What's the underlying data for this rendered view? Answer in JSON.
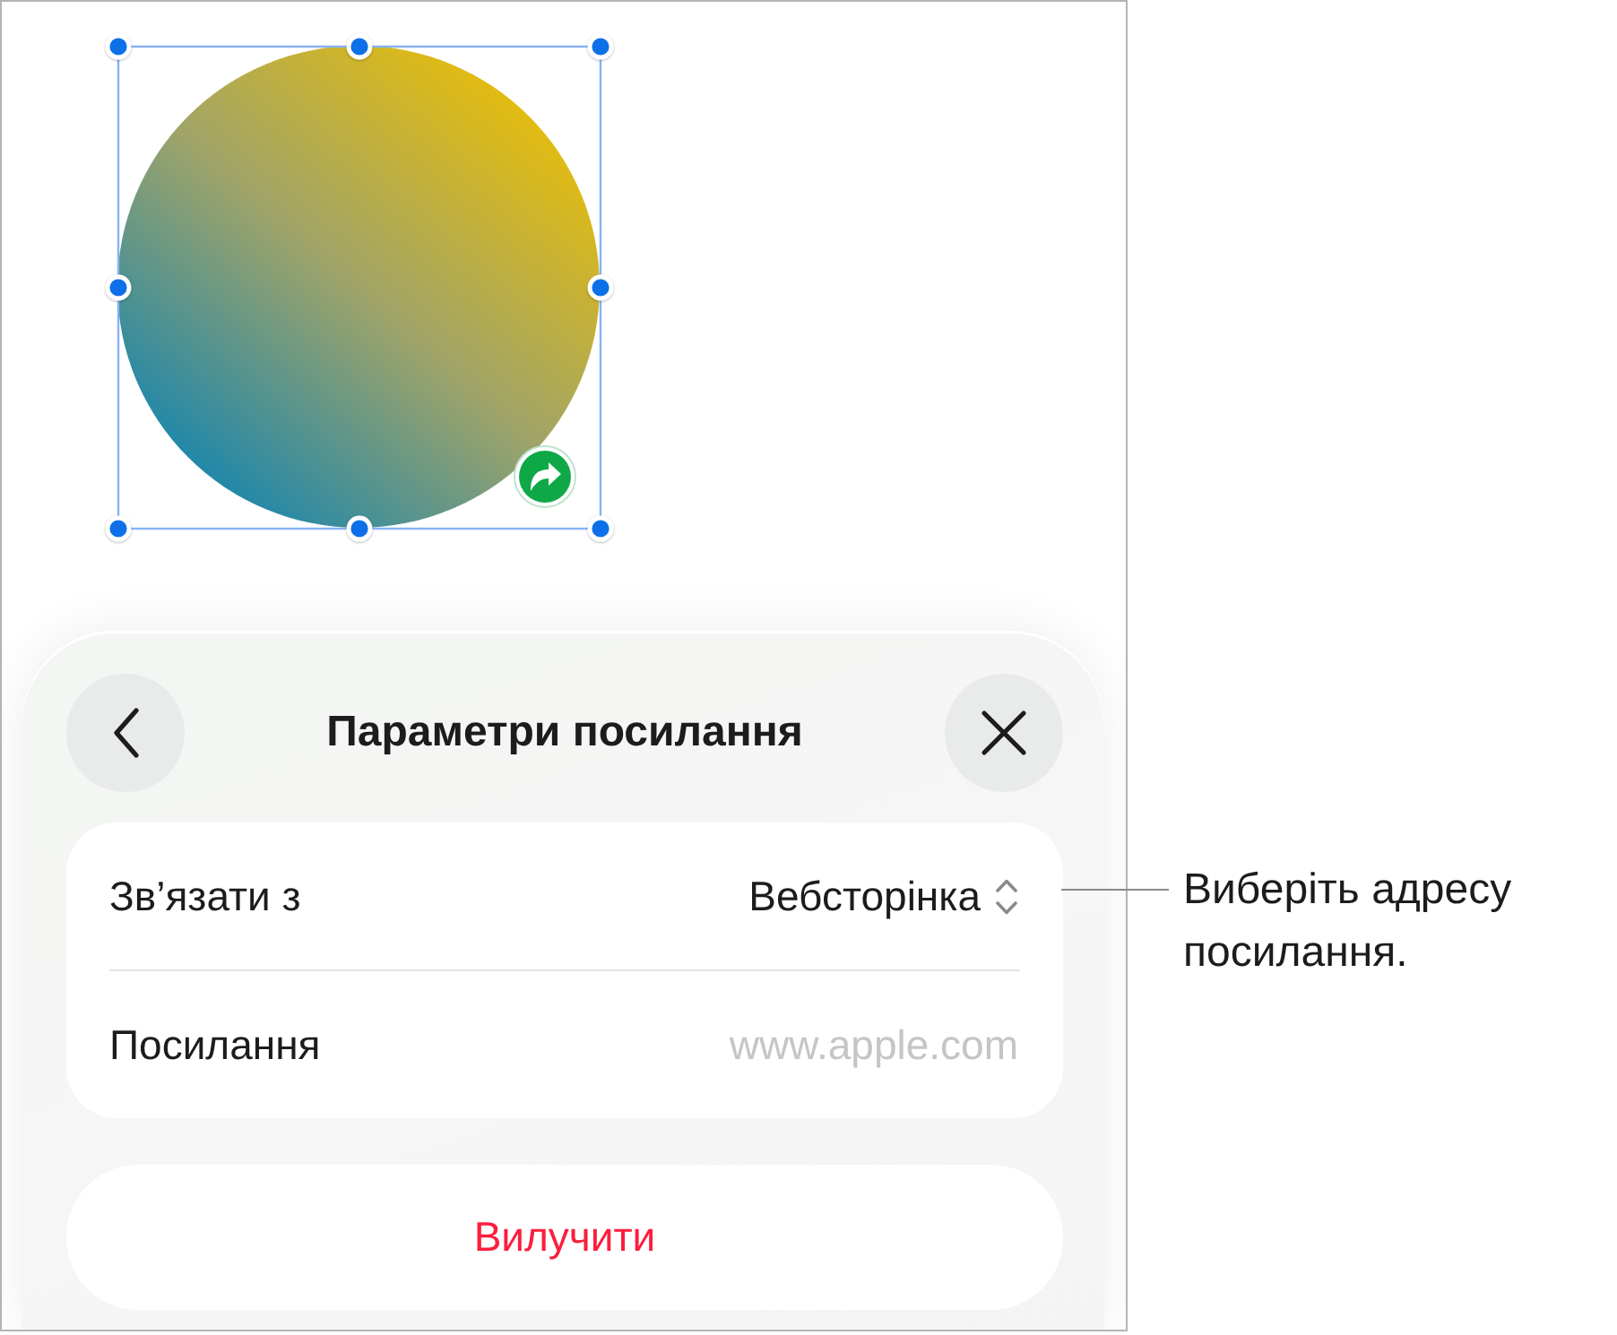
{
  "canvas": {
    "shape": {
      "selected": true,
      "link_badge": true
    }
  },
  "sheet": {
    "title": "Параметри посилання",
    "rows": [
      {
        "kind": "popup",
        "label": "Зв’язати з",
        "value": "Вебсторінка"
      },
      {
        "kind": "field",
        "label": "Посилання",
        "placeholder": "www.apple.com"
      }
    ],
    "delete_button": "Вилучити"
  },
  "callout": {
    "text": "Виберіть адресу посилання."
  }
}
